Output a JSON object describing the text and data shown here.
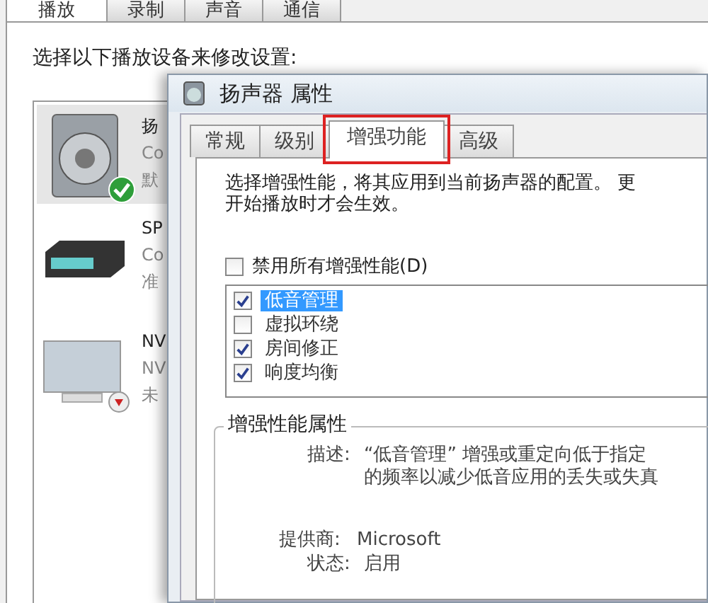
{
  "background_window": {
    "tabs": [
      {
        "label": "播放",
        "selected": true
      },
      {
        "label": "录制",
        "selected": false
      },
      {
        "label": "声音",
        "selected": false
      },
      {
        "label": "通信",
        "selected": false
      }
    ],
    "instruction": "选择以下播放设备来修改设置:",
    "devices": [
      {
        "kind": "speaker",
        "name": "扬",
        "line_2": "Co",
        "line_3": "默",
        "selected": true,
        "default": true
      },
      {
        "kind": "receiver",
        "name": "SP",
        "line_2": "Co",
        "line_3": "准",
        "selected": false,
        "default": false
      },
      {
        "kind": "monitor",
        "name": "NV",
        "line_2": "NV",
        "line_3": "未",
        "selected": false,
        "default": false
      }
    ]
  },
  "dialog": {
    "title": "扬声器 属性",
    "tabs": [
      {
        "label": "常规",
        "selected": false,
        "highlighted": false
      },
      {
        "label": "级别",
        "selected": false,
        "highlighted": false
      },
      {
        "label": "增强功能",
        "selected": true,
        "highlighted": true
      },
      {
        "label": "高级",
        "selected": false,
        "highlighted": false
      }
    ],
    "intro_line_1": "选择增强性能，将其应用到当前扬声器的配置。 更",
    "intro_line_2": "开始播放时才会生效。",
    "disable_all": {
      "label": "禁用所有增强性能(D)",
      "checked": false
    },
    "enhancements": [
      {
        "label": "低音管理",
        "checked": true,
        "selected": true
      },
      {
        "label": "虚拟环绕",
        "checked": false,
        "selected": false
      },
      {
        "label": "房间修正",
        "checked": true,
        "selected": false
      },
      {
        "label": "响度均衡",
        "checked": true,
        "selected": false
      }
    ],
    "properties_group": {
      "title": "增强性能属性",
      "description_label": "描述:",
      "description_line_1": "“低音管理” 增强或重定向低于指定",
      "description_line_2": "的频率以减少低音应用的丢失或失真",
      "provider_label": "提供商:",
      "provider": "Microsoft",
      "status_label": "状态:",
      "status": "启用"
    }
  }
}
